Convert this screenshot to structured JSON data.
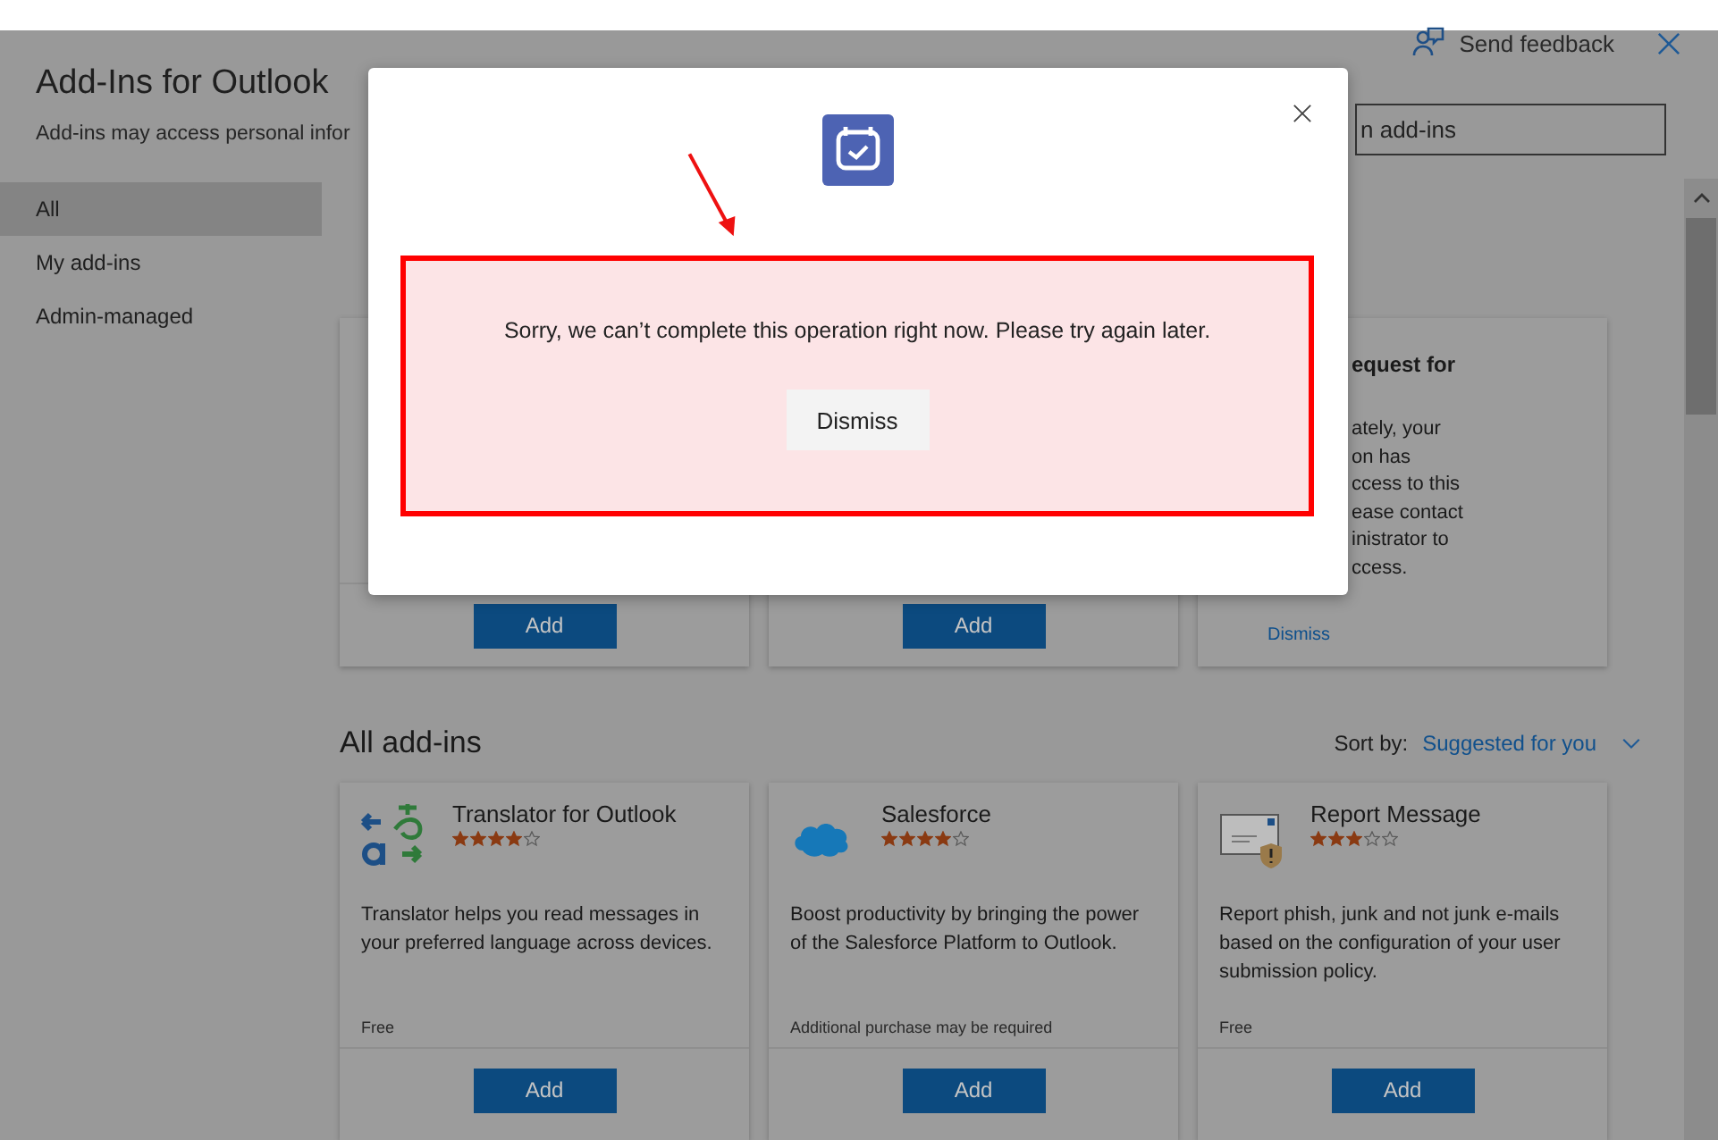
{
  "header": {
    "title": "Add-Ins for Outlook",
    "subtitle": "Add-ins may access personal infor",
    "feedback": "Send feedback",
    "search": {
      "placeholder": "n add-ins"
    }
  },
  "sidebar": {
    "items": [
      {
        "label": "All",
        "selected": true
      },
      {
        "label": "My add-ins",
        "selected": false
      },
      {
        "label": "Admin-managed",
        "selected": false
      }
    ]
  },
  "top_cards": [
    {
      "kind": "add",
      "button": "Add"
    },
    {
      "kind": "add",
      "button": "Add"
    },
    {
      "kind": "notice",
      "title": "equest for",
      "lines": [
        "ately, your",
        "on has",
        "ccess to this",
        "ease contact",
        "inistrator to",
        "ccess."
      ],
      "link": "Dismiss"
    }
  ],
  "all_addins": {
    "heading": "All add-ins",
    "sort_label": "Sort by:",
    "sort_value": "Suggested for you",
    "cards": [
      {
        "name": "Translator for Outlook",
        "stars": 4,
        "description": "Translator helps you read messages in your preferred language across devices.",
        "price": "Free",
        "button": "Add"
      },
      {
        "name": "Salesforce",
        "stars": 4,
        "description": "Boost productivity by bringing the power of the Salesforce Platform to Outlook.",
        "price": "Additional purchase may be required",
        "button": "Add"
      },
      {
        "name": "Report Message",
        "stars": 3,
        "description": "Report phish, junk and not junk e-mails based on the configuration of your user submission policy.",
        "price": "Free",
        "button": "Add"
      }
    ]
  },
  "dialog": {
    "message": "Sorry, we can’t complete this operation right now. Please try again later.",
    "button": "Dismiss"
  }
}
